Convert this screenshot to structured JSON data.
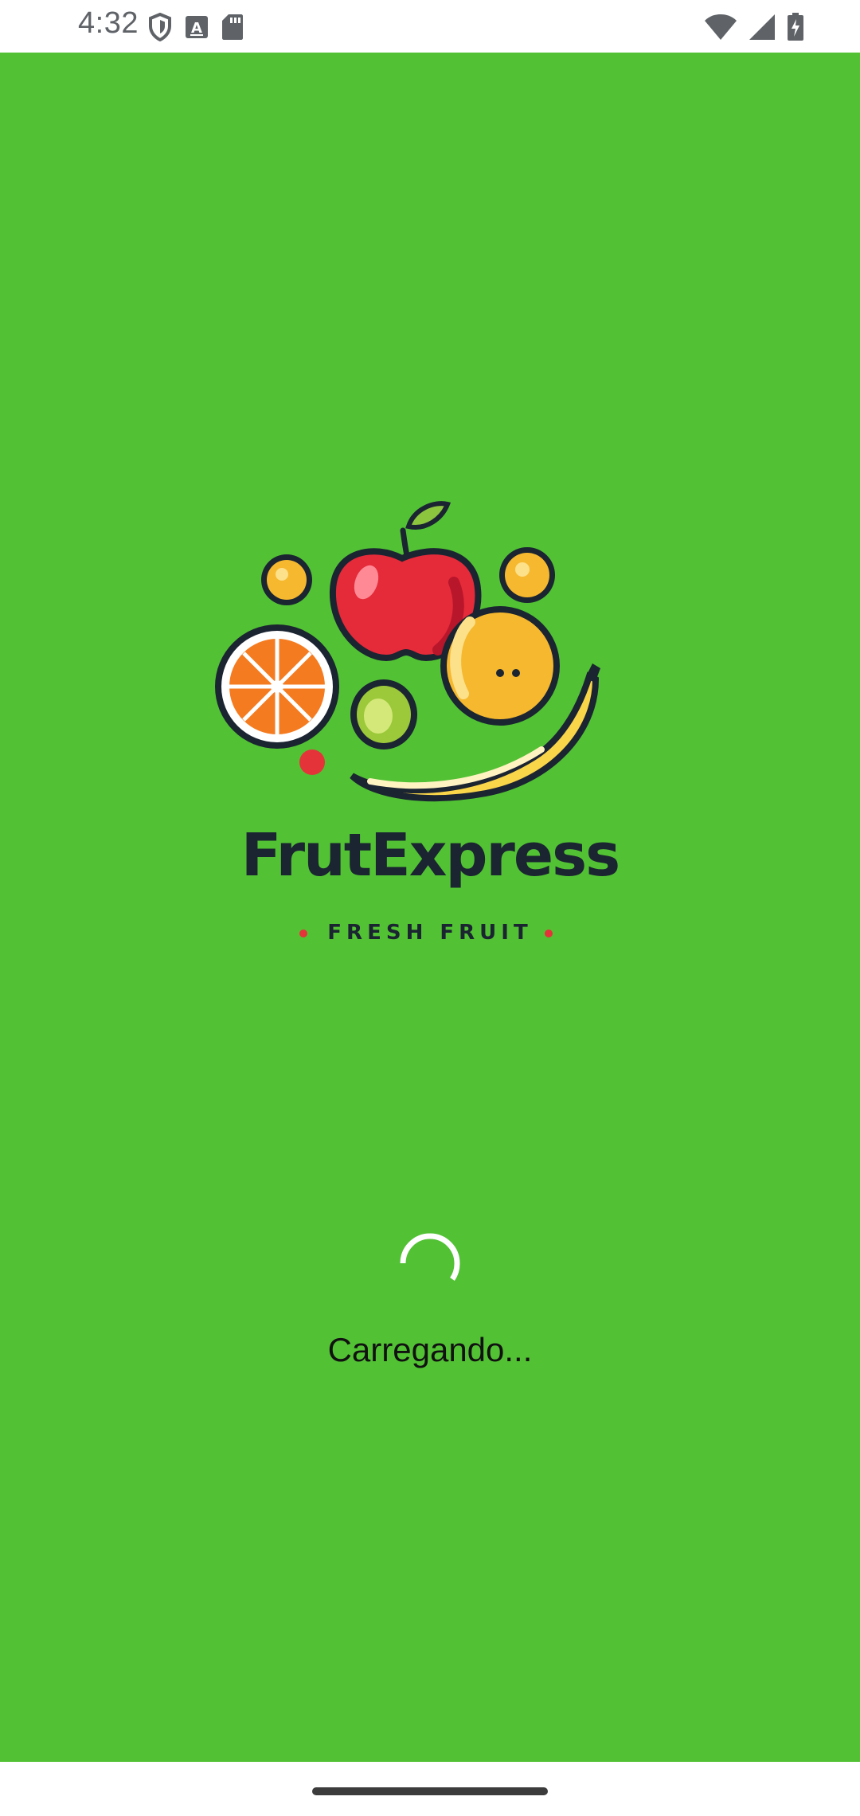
{
  "status_bar": {
    "time": "4:32",
    "left_icons": [
      "shield-icon",
      "keyboard-icon",
      "sd-card-icon"
    ],
    "right_icons": [
      "wifi-icon",
      "cell-signal-icon",
      "battery-charging-icon"
    ]
  },
  "splash": {
    "background_color": "#52c234",
    "brand_name": "FrutExpress",
    "tagline": "FRESH FRUIT",
    "loading_text": "Carregando..."
  },
  "nav_bar": {
    "indicator": "home-indicator"
  }
}
